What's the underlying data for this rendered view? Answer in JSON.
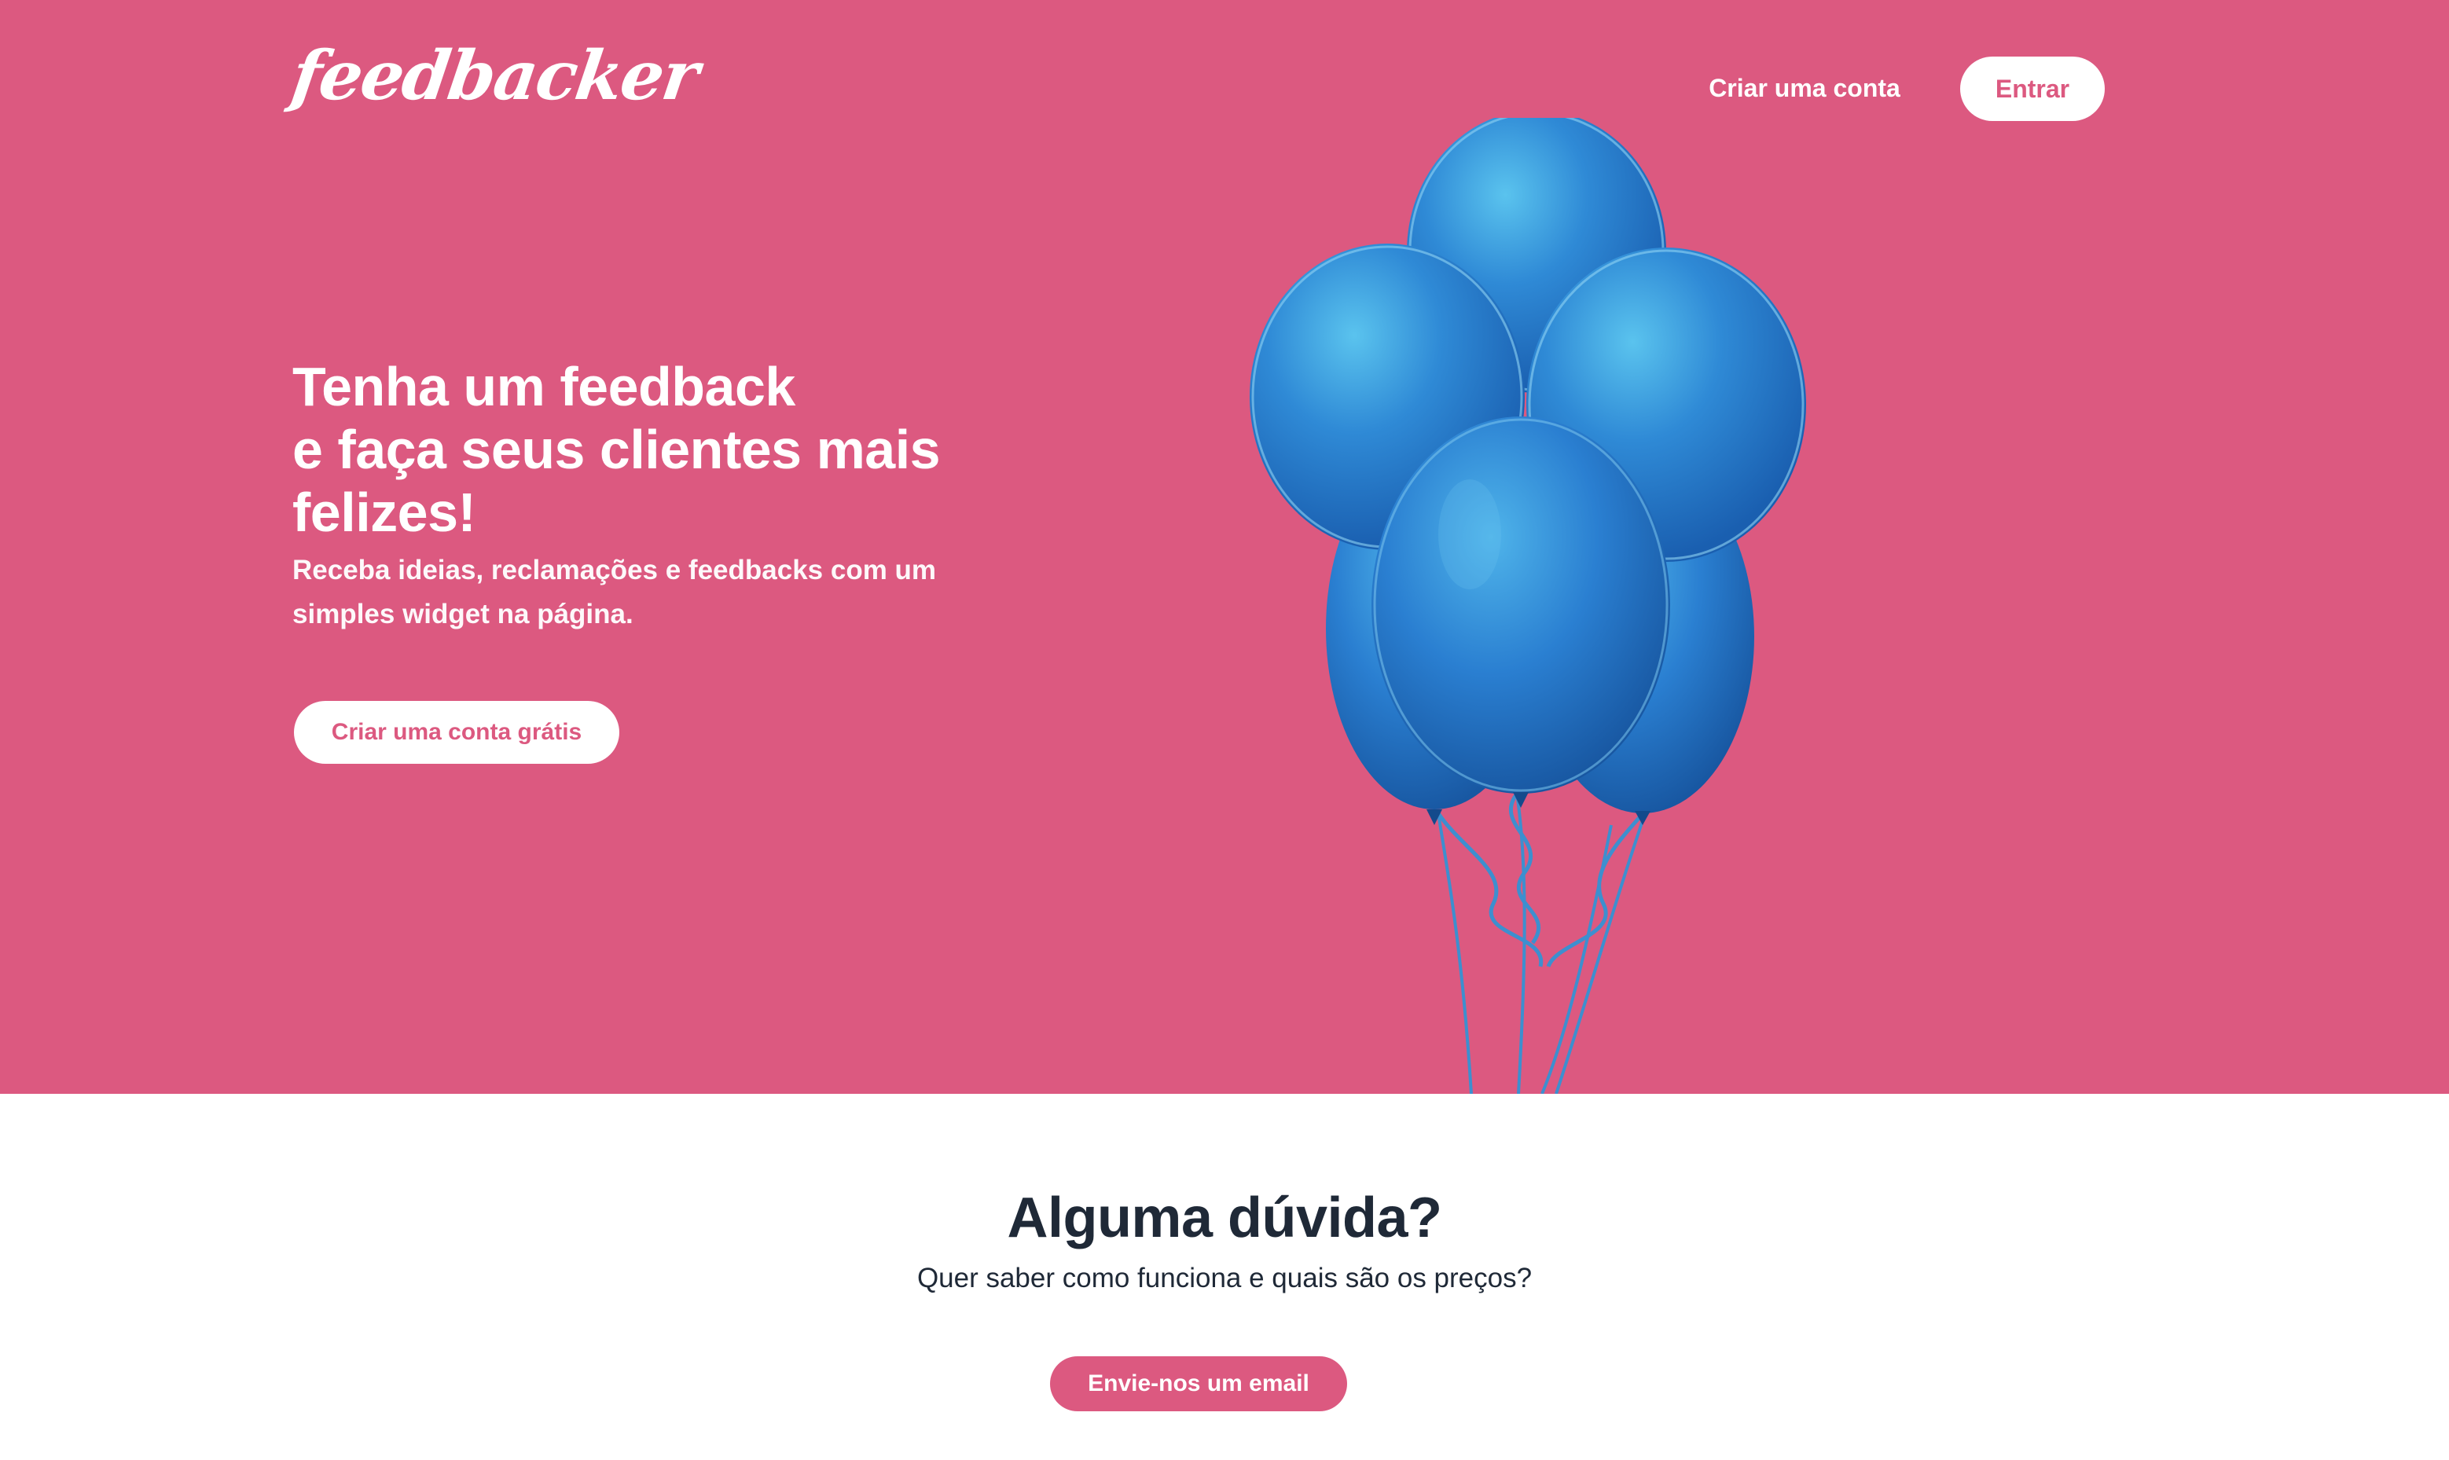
{
  "brand": {
    "logo_text": "feedbacker"
  },
  "nav": {
    "signup_label": "Criar uma conta",
    "login_label": "Entrar"
  },
  "hero": {
    "headline_lines": [
      "Tenha um feedback",
      "e faça seus clientes mais",
      "felizes!"
    ],
    "subtitle_lines": [
      "Receba ideias, reclamações e feedbacks com um",
      "simples widget na página."
    ],
    "cta_label": "Criar uma conta grátis",
    "illustration_icon": "balloons-illustration"
  },
  "faq": {
    "title": "Alguma dúvida?",
    "subtitle": "Quer saber como funciona e quais são os preços?",
    "email_button_label": "Envie-nos um email"
  },
  "colors": {
    "brand_pink": "#dc5980",
    "white": "#ffffff",
    "dark_text": "#1f2937",
    "balloon_blue": "#2a7fd1"
  }
}
